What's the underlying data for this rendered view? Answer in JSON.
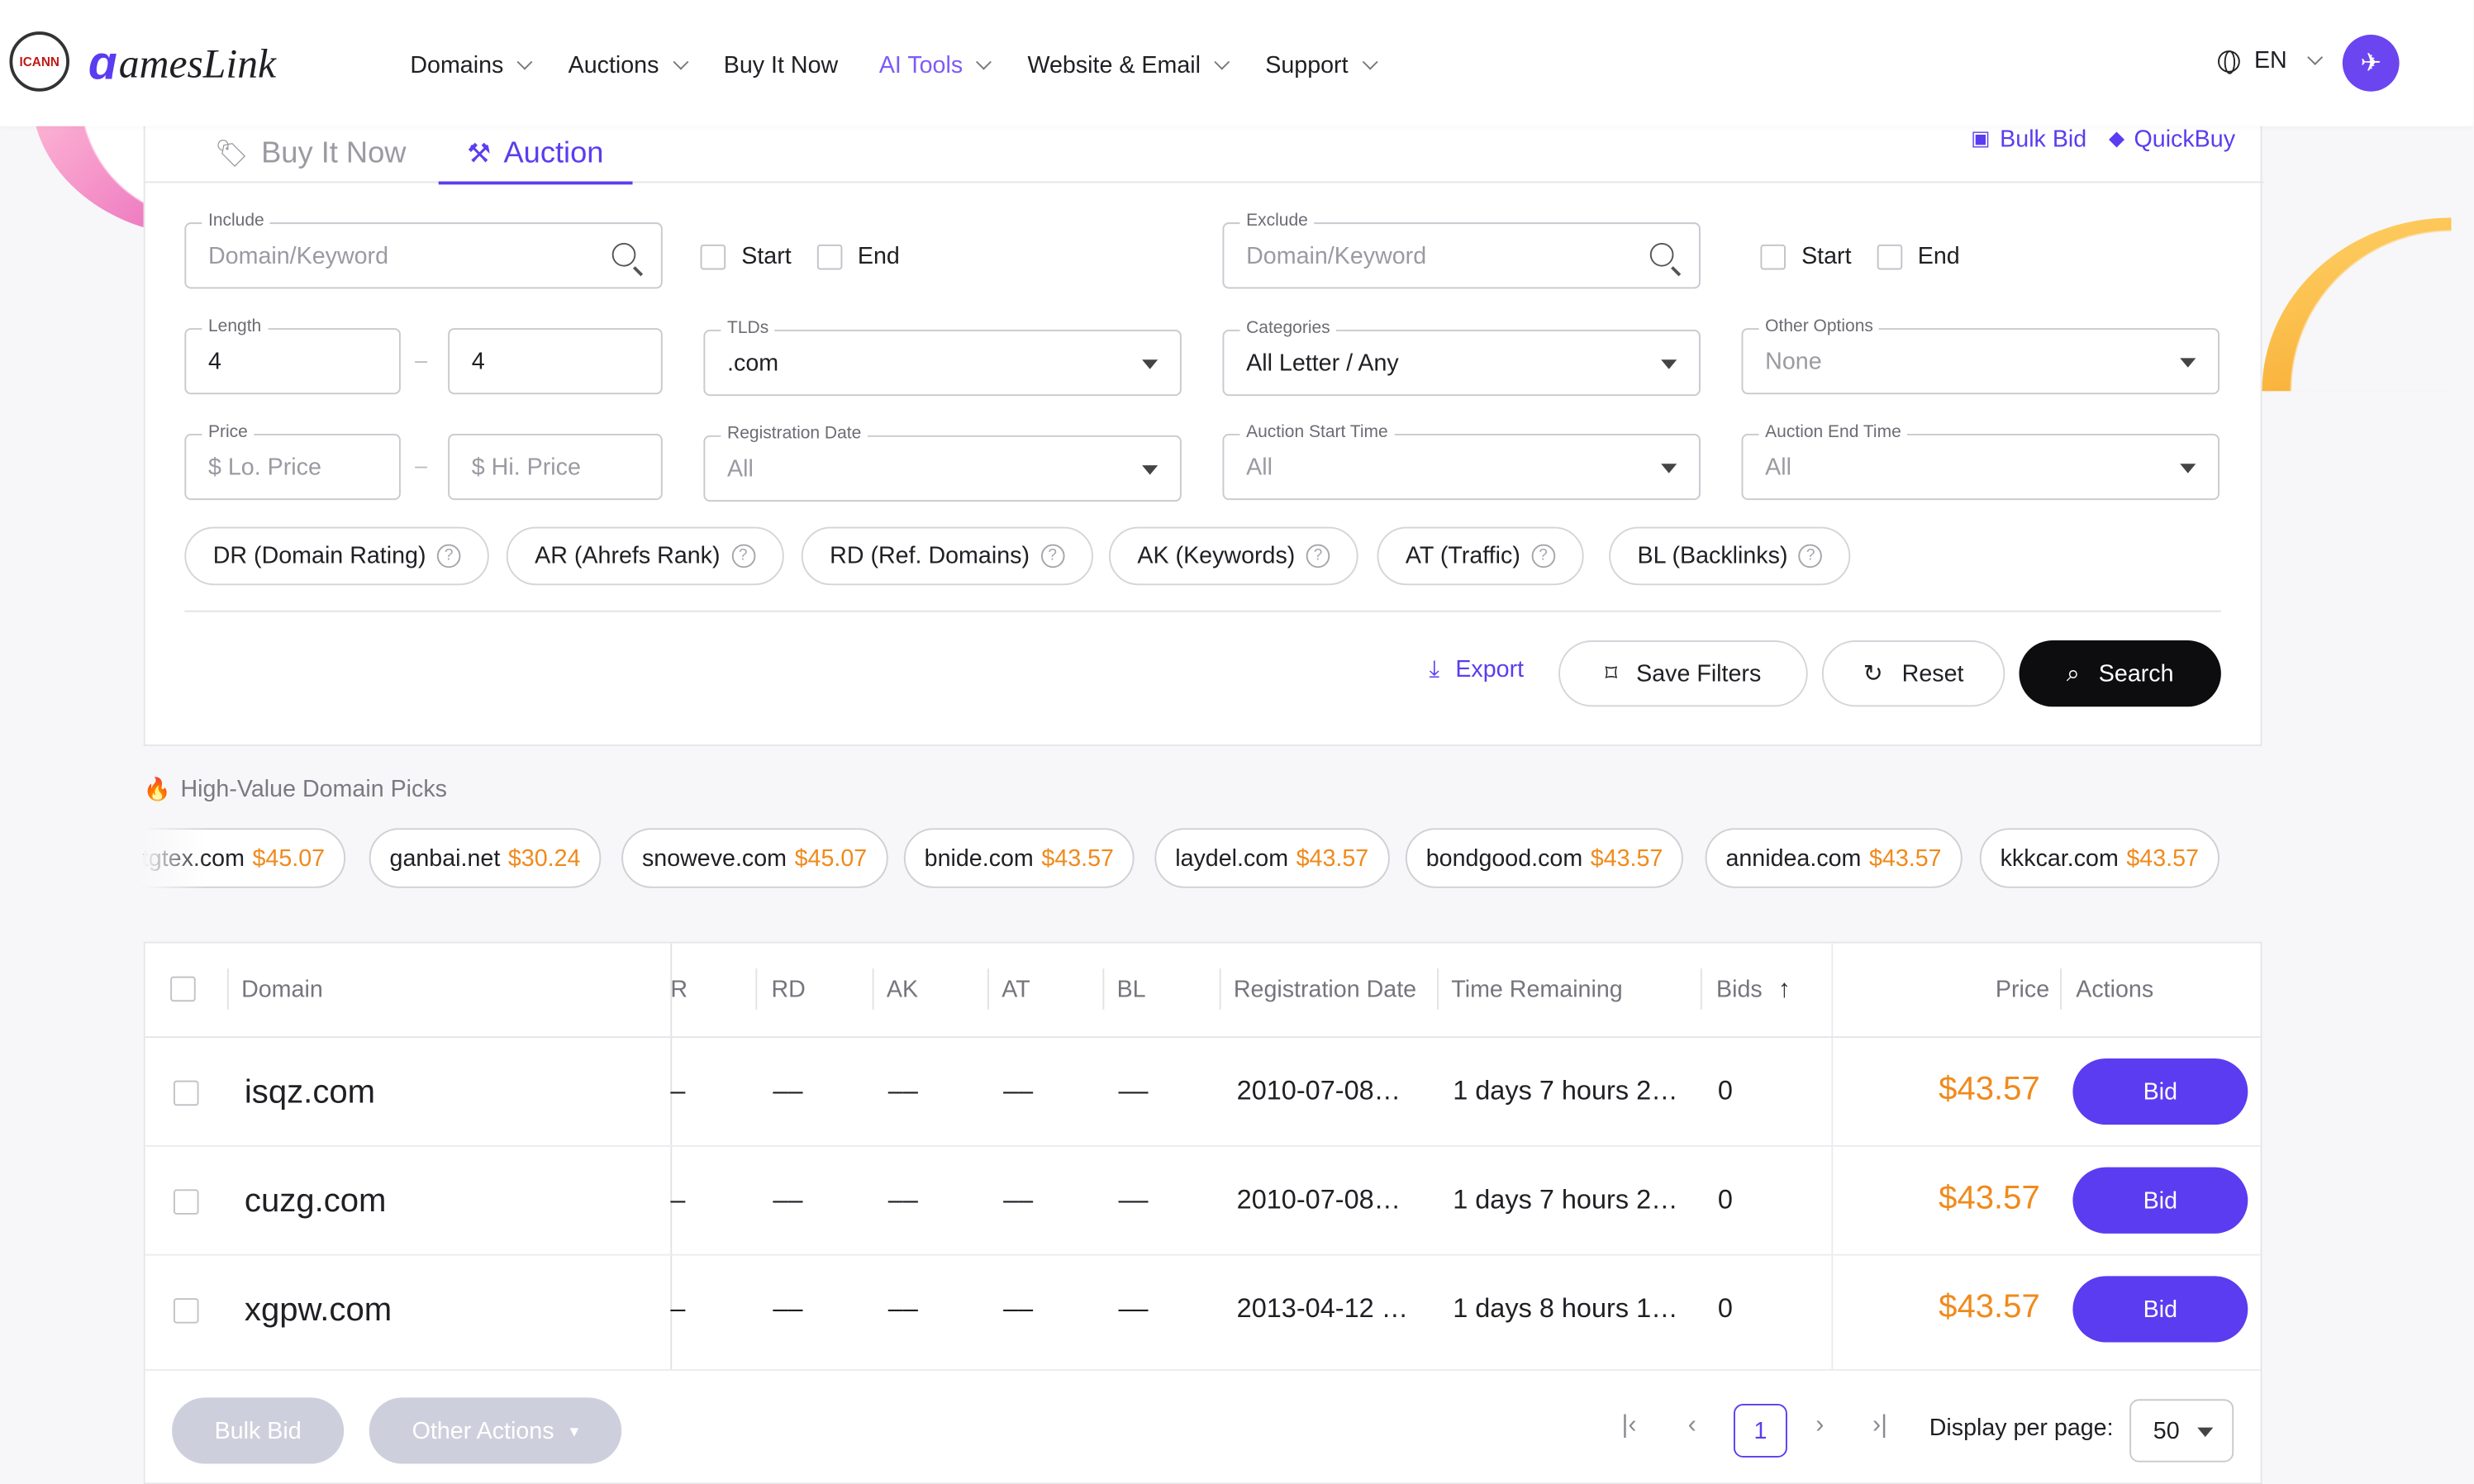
{
  "header": {
    "icann_badge": "ICANN",
    "logo_mark": "ɑ",
    "logo_text": "amesLink",
    "nav": [
      {
        "label": "Domains"
      },
      {
        "label": "Auctions"
      },
      {
        "label": "Buy It Now"
      },
      {
        "label": "AI Tools"
      },
      {
        "label": "Website & Email"
      },
      {
        "label": "Support"
      }
    ],
    "lang": "EN"
  },
  "tabs": {
    "buy_now": "Buy It Now",
    "auction": "Auction",
    "bulk_bid": "Bulk Bid",
    "quick_buy": "QuickBuy"
  },
  "filters": {
    "include_legend": "Include",
    "include_placeholder": "Domain/Keyword",
    "exclude_legend": "Exclude",
    "exclude_placeholder": "Domain/Keyword",
    "start_label": "Start",
    "end_label": "End",
    "length_legend": "Length",
    "length_min": "4",
    "length_max": "4",
    "tlds_legend": "TLDs",
    "tlds_value": ".com",
    "categories_legend": "Categories",
    "categories_value": "All Letter / Any",
    "other_options_legend": "Other Options",
    "other_options_value": "None",
    "price_legend": "Price",
    "price_lo_placeholder": "$  Lo. Price",
    "price_hi_placeholder": "$  Hi. Price",
    "registration_date_legend": "Registration Date",
    "registration_date_value": "All",
    "auction_start_legend": "Auction Start Time",
    "auction_start_value": "All",
    "auction_end_legend": "Auction End Time",
    "auction_end_value": "All",
    "metric_chips": [
      "DR (Domain Rating)",
      "AR (Ahrefs Rank)",
      "RD (Ref. Domains)",
      "AK (Keywords)",
      "AT (Traffic)",
      "BL (Backlinks)"
    ],
    "export_label": "Export",
    "save_filters_label": "Save Filters",
    "reset_label": "Reset",
    "search_label": "Search"
  },
  "picks": {
    "title": "High-Value Domain Picks",
    "items": [
      {
        "domain": "tgtex.com",
        "price": "$45.07"
      },
      {
        "domain": "ganbai.net",
        "price": "$30.24"
      },
      {
        "domain": "snoweve.com",
        "price": "$45.07"
      },
      {
        "domain": "bnide.com",
        "price": "$43.57"
      },
      {
        "domain": "laydel.com",
        "price": "$43.57"
      },
      {
        "domain": "bondgood.com",
        "price": "$43.57"
      },
      {
        "domain": "annidea.com",
        "price": "$43.57"
      },
      {
        "domain": "kkkcar.com",
        "price": "$43.57"
      }
    ]
  },
  "table": {
    "headers": {
      "domain": "Domain",
      "ar": "R",
      "rd": "RD",
      "ak": "AK",
      "at": "AT",
      "bl": "BL",
      "registration_date": "Registration Date",
      "time_remaining": "Time Remaining",
      "bids": "Bids",
      "price": "Price",
      "actions": "Actions"
    },
    "rows": [
      {
        "domain": "isqz.com",
        "ar": "–",
        "rd": "––",
        "ak": "––",
        "at": "––",
        "bl": "––",
        "registration_date": "2010-07-08…",
        "time_remaining": "1 days 7 hours 2…",
        "bids": "0",
        "price": "$43.57",
        "action": "Bid"
      },
      {
        "domain": "cuzg.com",
        "ar": "–",
        "rd": "––",
        "ak": "––",
        "at": "––",
        "bl": "––",
        "registration_date": "2010-07-08…",
        "time_remaining": "1 days 7 hours 2…",
        "bids": "0",
        "price": "$43.57",
        "action": "Bid"
      },
      {
        "domain": "xgpw.com",
        "ar": "–",
        "rd": "––",
        "ak": "––",
        "at": "––",
        "bl": "––",
        "registration_date": "2013-04-12 …",
        "time_remaining": "1 days 8 hours 1…",
        "bids": "0",
        "price": "$43.57",
        "action": "Bid"
      }
    ],
    "footer": {
      "bulk_bid": "Bulk Bid",
      "other_actions": "Other Actions",
      "current_page": "1",
      "per_page_label": "Display per page:",
      "per_page_value": "50"
    }
  },
  "colors": {
    "accent": "#5b3cf0",
    "price": "#f08a1c",
    "dark_button": "#0d0d0f"
  }
}
